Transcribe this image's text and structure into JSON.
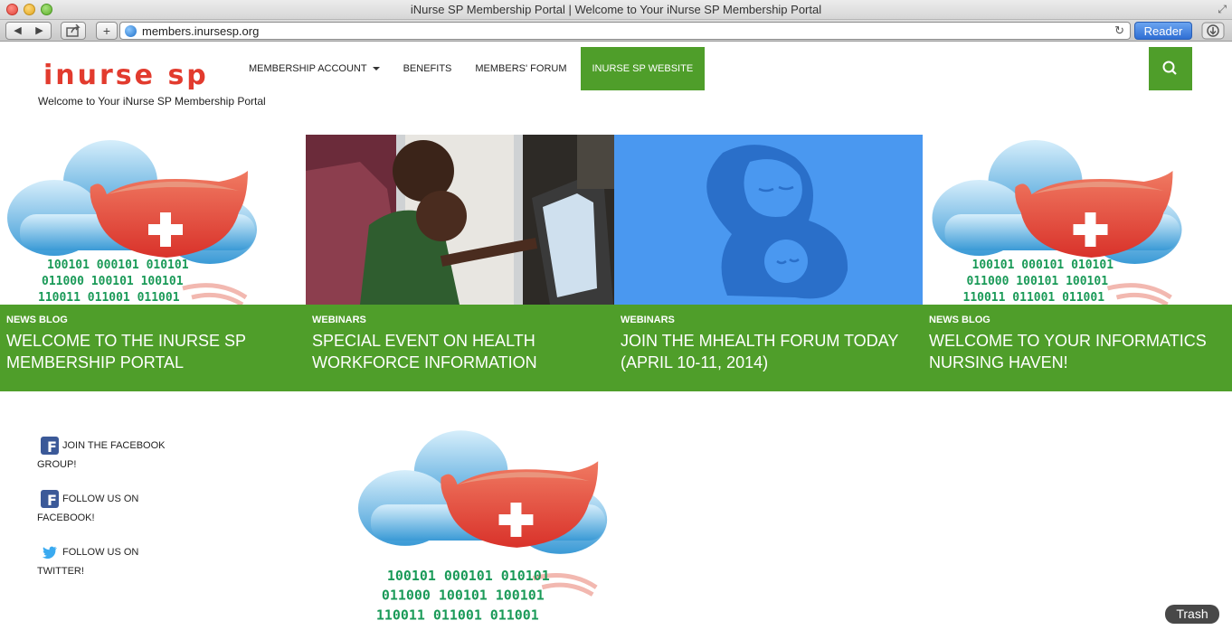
{
  "window": {
    "title": "iNurse SP Membership Portal | Welcome to Your iNurse SP Membership Portal"
  },
  "browser": {
    "url": "members.inursesp.org",
    "reader_label": "Reader",
    "back_icon": "back-arrow-icon",
    "forward_icon": "forward-arrow-icon"
  },
  "site": {
    "logo_text": "inurse sp",
    "tagline": "Welcome to Your iNurse SP Membership Portal",
    "accent_color": "#4f9e2a",
    "logo_color": "#e23b2e"
  },
  "nav": {
    "items": [
      {
        "label": "MEMBERSHIP ACCOUNT"
      },
      {
        "label": "BENEFITS"
      },
      {
        "label": "MEMBERS' FORUM"
      },
      {
        "label": "INURSE SP WEBSITE"
      }
    ]
  },
  "features": [
    {
      "category": "NEWS BLOG",
      "title": "WELCOME TO THE INURSE SP MEMBERSHIP PORTAL"
    },
    {
      "category": "WEBINARS",
      "title": "SPECIAL EVENT ON HEALTH WORKFORCE INFORMATION"
    },
    {
      "category": "WEBINARS",
      "title": "JOIN THE MHEALTH FORUM TODAY (APRIL 10-11, 2014)"
    },
    {
      "category": "NEWS BLOG",
      "title": "WELCOME TO YOUR INFORMATICS NURSING HAVEN!"
    }
  ],
  "binary": {
    "row1": "100101  000101   010101",
    "row2": "011000   100101   100101",
    "row3": "110011    011001   011001"
  },
  "social": {
    "items": [
      {
        "label": "JOIN THE FACEBOOK GROUP!"
      },
      {
        "label": "FOLLOW US ON FACEBOOK!"
      },
      {
        "label": "FOLLOW US ON TWITTER!"
      }
    ]
  },
  "dock": {
    "trash_label": "Trash"
  }
}
